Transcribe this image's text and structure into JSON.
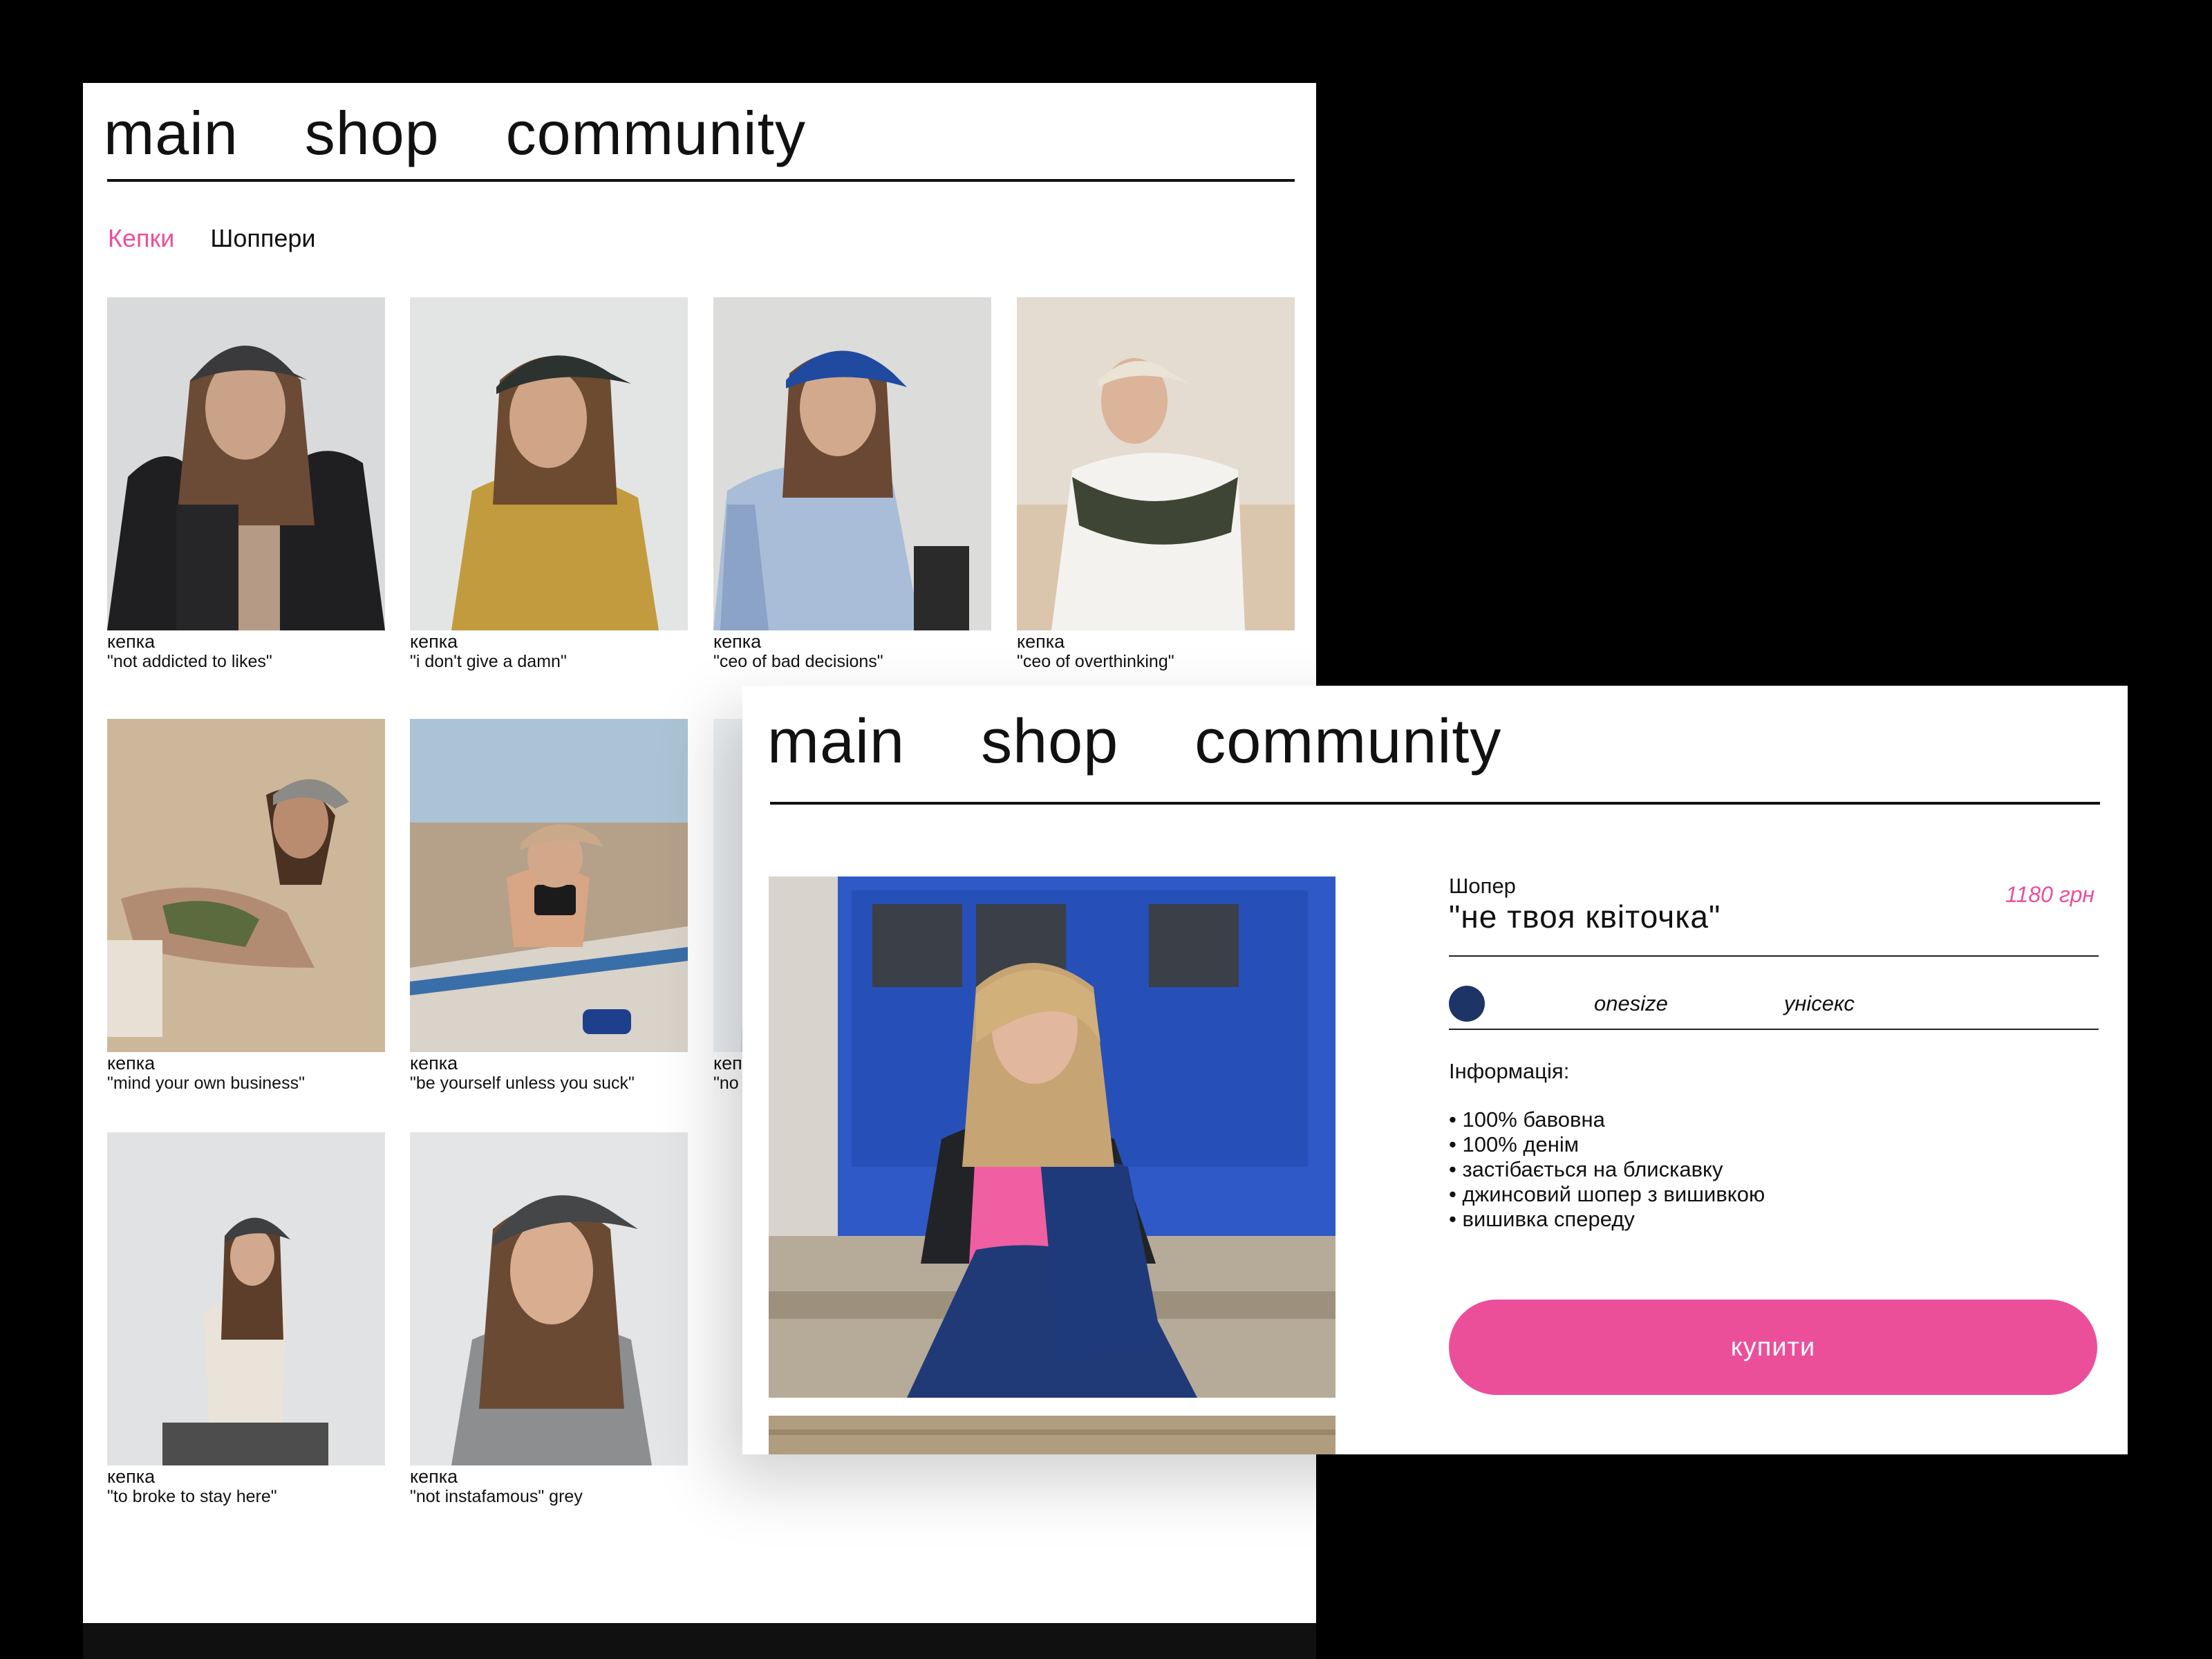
{
  "shop_page": {
    "nav": {
      "main": "main",
      "shop": "shop",
      "community": "community"
    },
    "categories": [
      {
        "label": "Кепки",
        "active": true
      },
      {
        "label": "Шоппери",
        "active": false
      }
    ],
    "products": [
      {
        "type": "кепка",
        "name": "\"not addicted to likes\"",
        "cap_color": "#3a3a3c"
      },
      {
        "type": "кепка",
        "name": "\"i don't give a damn\"",
        "cap_color": "#2b3230"
      },
      {
        "type": "кепка",
        "name": "\"ceo of bad decisions\"",
        "cap_color": "#1f4aa0"
      },
      {
        "type": "кепка",
        "name": "\"ceo of overthinking\"",
        "cap_color": "#eae3d6"
      },
      {
        "type": "кепка",
        "name": "\"mind your own business\"",
        "cap_color": "#8b8a86"
      },
      {
        "type": "кепка",
        "name": "\"be yourself unless you suck\"",
        "cap_color": "#c9a98a"
      },
      {
        "type": "кеп",
        "name": "\"no",
        "cap_color": "#dfe4ea"
      },
      {
        "type": "кепка",
        "name": "\"to broke to stay here\"",
        "cap_color": "#3d3f40"
      },
      {
        "type": "кепка",
        "name": "\"not instafamous\" grey",
        "cap_color": "#444648"
      }
    ]
  },
  "product_page": {
    "nav": {
      "main": "main",
      "shop": "shop",
      "community": "community"
    },
    "product": {
      "type": "Шопер",
      "name": "\"не твоя квіточка\"",
      "price": "1180 грн",
      "color_swatch": "#1c3566",
      "size": "onesize",
      "gender": "унісекс",
      "info_title": "Інформація:",
      "info": [
        "100% бавовна",
        "100% денім",
        "застібається на блискавку",
        "джинсовий шопер з вишивкою",
        "вишивка спереду"
      ],
      "buy_label": "купити"
    }
  },
  "colors": {
    "accent": "#ec4f9a",
    "background": "#000000",
    "panel": "#ffffff",
    "text": "#111111"
  }
}
